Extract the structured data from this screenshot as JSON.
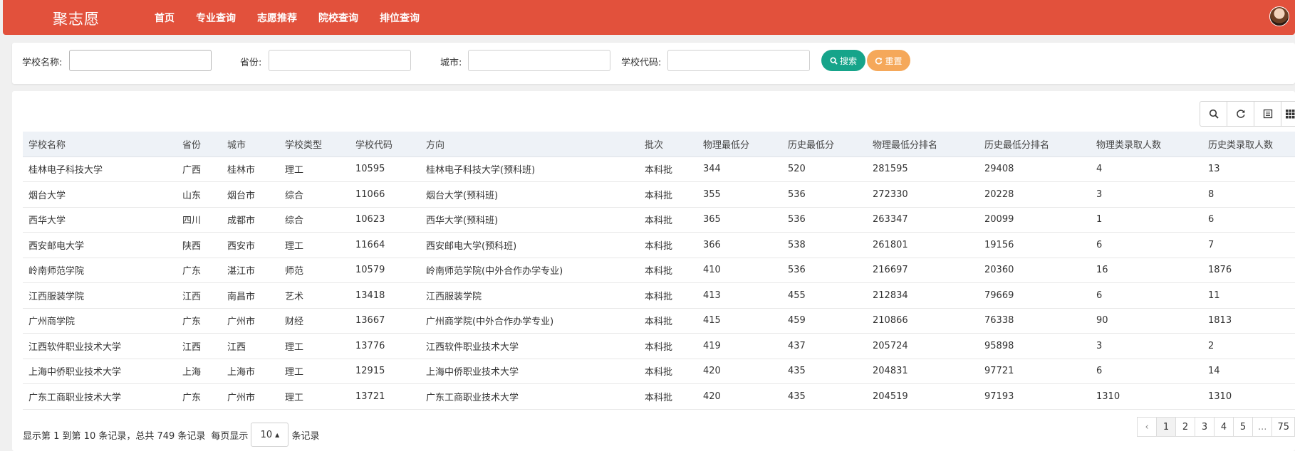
{
  "nav": {
    "brand": "聚志愿",
    "links": [
      "首页",
      "专业查询",
      "志愿推荐",
      "院校查询",
      "排位查询"
    ]
  },
  "search": {
    "school_name_label": "学校名称:",
    "province_label": "省份:",
    "city_label": "城市:",
    "school_code_label": "学校代码:",
    "search_button": "搜索",
    "reset_button": "重置"
  },
  "colors": {
    "nav_bg": "#e2513c",
    "search_btn": "#16a48a",
    "reset_btn": "#f5a85a",
    "header_bg": "#eef2f7"
  },
  "toolbar_icons": [
    "search-icon",
    "refresh-icon",
    "toggle-view-icon",
    "columns-icon"
  ],
  "table": {
    "columns": [
      "学校名称",
      "省份",
      "城市",
      "学校类型",
      "学校代码",
      "方向",
      "批次",
      "物理最低分",
      "历史最低分",
      "物理最低分排名",
      "历史最低分排名",
      "物理类录取人数",
      "历史类录取人数"
    ],
    "rows": [
      [
        "桂林电子科技大学",
        "广西",
        "桂林市",
        "理工",
        "10595",
        "桂林电子科技大学(预科班)",
        "本科批",
        "344",
        "520",
        "281595",
        "29408",
        "4",
        "13"
      ],
      [
        "烟台大学",
        "山东",
        "烟台市",
        "综合",
        "11066",
        "烟台大学(预科班)",
        "本科批",
        "355",
        "536",
        "272330",
        "20228",
        "3",
        "8"
      ],
      [
        "西华大学",
        "四川",
        "成都市",
        "综合",
        "10623",
        "西华大学(预科班)",
        "本科批",
        "365",
        "536",
        "263347",
        "20099",
        "1",
        "6"
      ],
      [
        "西安邮电大学",
        "陕西",
        "西安市",
        "理工",
        "11664",
        "西安邮电大学(预科班)",
        "本科批",
        "366",
        "538",
        "261801",
        "19156",
        "6",
        "7"
      ],
      [
        "岭南师范学院",
        "广东",
        "湛江市",
        "师范",
        "10579",
        "岭南师范学院(中外合作办学专业)",
        "本科批",
        "410",
        "536",
        "216697",
        "20360",
        "16",
        "1876"
      ],
      [
        "江西服装学院",
        "江西",
        "南昌市",
        "艺术",
        "13418",
        "江西服装学院",
        "本科批",
        "413",
        "455",
        "212834",
        "79669",
        "6",
        "11"
      ],
      [
        "广州商学院",
        "广东",
        "广州市",
        "财经",
        "13667",
        "广州商学院(中外合作办学专业)",
        "本科批",
        "415",
        "459",
        "210866",
        "76338",
        "90",
        "1813"
      ],
      [
        "江西软件职业技术大学",
        "江西",
        "江西",
        "理工",
        "13776",
        "江西软件职业技术大学",
        "本科批",
        "419",
        "437",
        "205724",
        "95898",
        "3",
        "2"
      ],
      [
        "上海中侨职业技术大学",
        "上海",
        "上海市",
        "理工",
        "12915",
        "上海中侨职业技术大学",
        "本科批",
        "420",
        "435",
        "204831",
        "97721",
        "6",
        "14"
      ],
      [
        "广东工商职业技术大学",
        "广东",
        "广州市",
        "理工",
        "13721",
        "广东工商职业技术大学",
        "本科批",
        "420",
        "435",
        "204519",
        "97193",
        "1310",
        "1310"
      ]
    ]
  },
  "footer": {
    "summary": "显示第 1 到第 10 条记录，总共 749 条记录",
    "per_page_prefix": "每页显示",
    "page_size": "10",
    "per_page_suffix": "条记录"
  },
  "pagination": {
    "prev": "‹",
    "pages": [
      "1",
      "2",
      "3",
      "4",
      "5",
      "...",
      "75"
    ],
    "active": "1"
  }
}
